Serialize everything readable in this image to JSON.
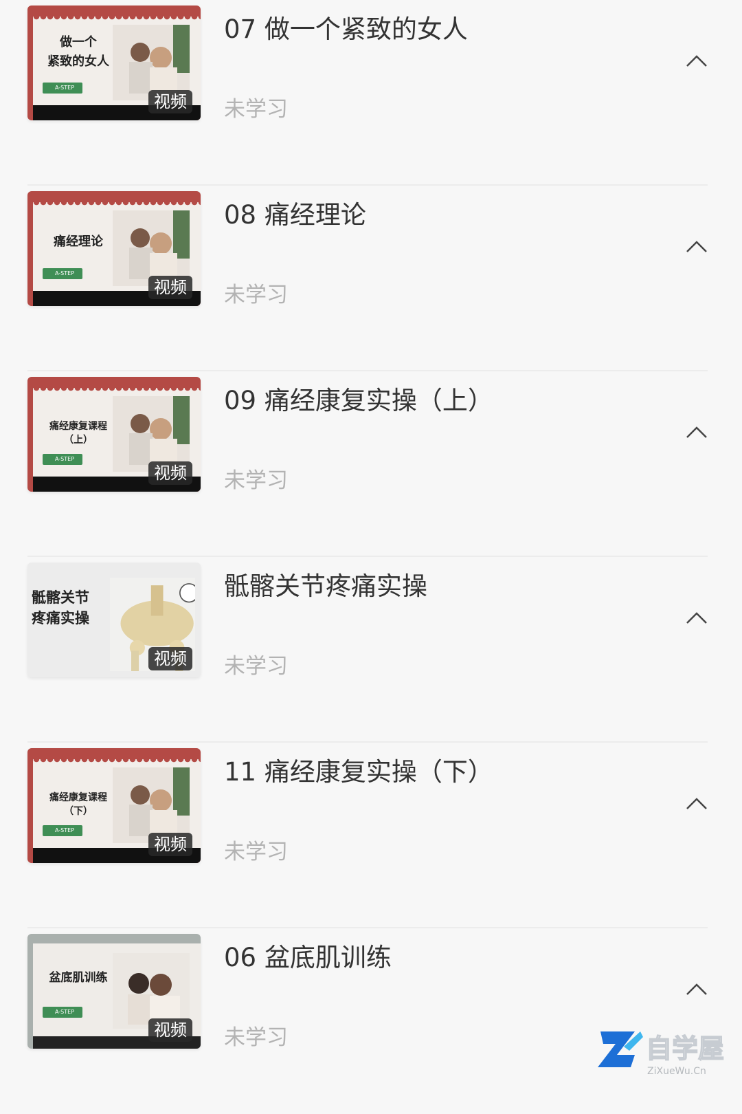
{
  "course_items": [
    {
      "title": "07 做一个紧致的女人",
      "status": "未学习",
      "thumb_text": "做一个\n紧致的女人",
      "thumb_style": "red",
      "badge": "视频",
      "logo": "A-STEP"
    },
    {
      "title": "08 痛经理论",
      "status": "未学习",
      "thumb_text": "痛经理论",
      "thumb_style": "red",
      "badge": "视频",
      "logo": "A-STEP"
    },
    {
      "title": "09 痛经康复实操（上）",
      "status": "未学习",
      "thumb_text": "痛经康复课程\n（上）",
      "thumb_style": "red",
      "badge": "视频",
      "logo": "A-STEP"
    },
    {
      "title": "骶髂关节疼痛实操",
      "status": "未学习",
      "thumb_text": "骶髂关节\n疼痛实操",
      "thumb_style": "light",
      "badge": "视频",
      "logo": ""
    },
    {
      "title": "11 痛经康复实操（下）",
      "status": "未学习",
      "thumb_text": "痛经康复课程\n（下）",
      "thumb_style": "red",
      "badge": "视频",
      "logo": "A-STEP"
    },
    {
      "title": "06 盆底肌训练",
      "status": "未学习",
      "thumb_text": "盆底肌训练",
      "thumb_style": "gray",
      "badge": "视频",
      "logo": "A-STEP"
    }
  ],
  "watermark": {
    "name": "自学屋",
    "domain": "ZiXueWu.Cn"
  },
  "colors": {
    "accent_red": "#b44a45",
    "status_gray": "#b3b3b3",
    "logo_green": "#3f8e55"
  }
}
